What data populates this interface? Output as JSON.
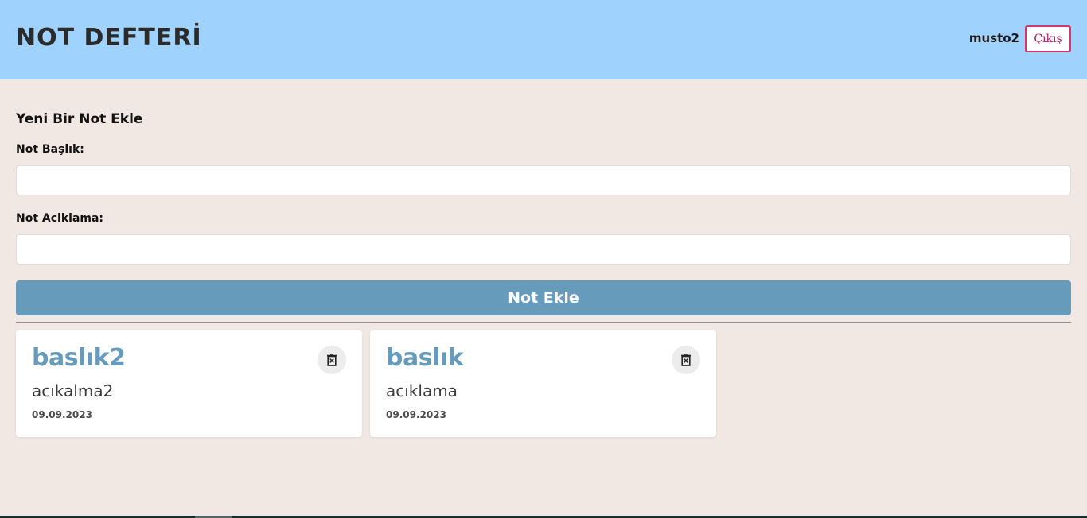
{
  "header": {
    "app_title": "NOT DEFTERİ",
    "user_name": "musto2",
    "logout_label": "Çıkış"
  },
  "form": {
    "title": "Yeni Bir Not Ekle",
    "title_label": "Not Başlık:",
    "title_value": "",
    "description_label": "Not Aciklama:",
    "description_value": "",
    "submit_label": "Not Ekle"
  },
  "notes": [
    {
      "title": "baslık2",
      "description": "acıkalma2",
      "date": "09.09.2023",
      "delete_icon": "trash-x-icon"
    },
    {
      "title": "baslık",
      "description": "acıklama",
      "date": "09.09.2023",
      "delete_icon": "trash-x-icon"
    }
  ],
  "colors": {
    "header_bg": "#a0d2fe",
    "page_bg": "#f2e8e3",
    "accent": "#669bbc",
    "logout_border": "#d8336f"
  }
}
